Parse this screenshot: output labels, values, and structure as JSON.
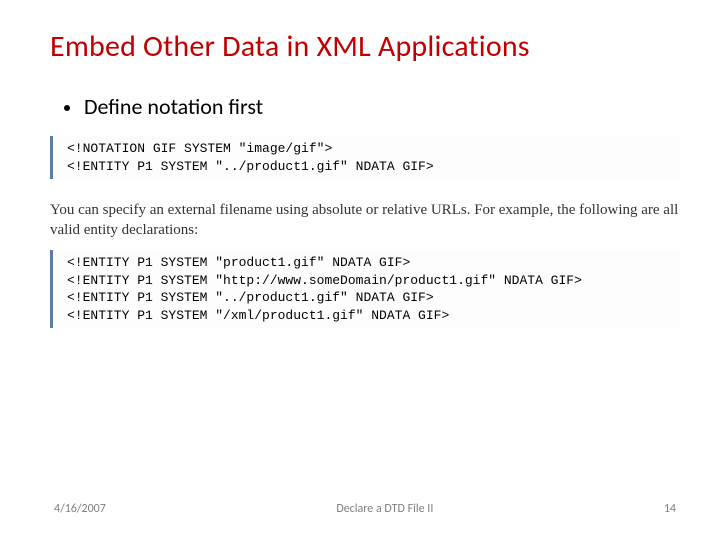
{
  "title": "Embed Other Data in XML Applications",
  "bullet1": "Define notation first",
  "code1": "<!NOTATION GIF SYSTEM \"image/gif\">\n<!ENTITY P1 SYSTEM \"../product1.gif\" NDATA GIF>",
  "para": "You can specify an external filename using absolute or relative URLs. For example, the following are all valid entity declarations:",
  "code2": "<!ENTITY P1 SYSTEM \"product1.gif\" NDATA GIF>\n<!ENTITY P1 SYSTEM \"http://www.someDomain/product1.gif\" NDATA GIF>\n<!ENTITY P1 SYSTEM \"../product1.gif\" NDATA GIF>\n<!ENTITY P1 SYSTEM \"/xml/product1.gif\" NDATA GIF>",
  "footer": {
    "date": "4/16/2007",
    "center": "Declare a DTD File II",
    "page": "14"
  }
}
